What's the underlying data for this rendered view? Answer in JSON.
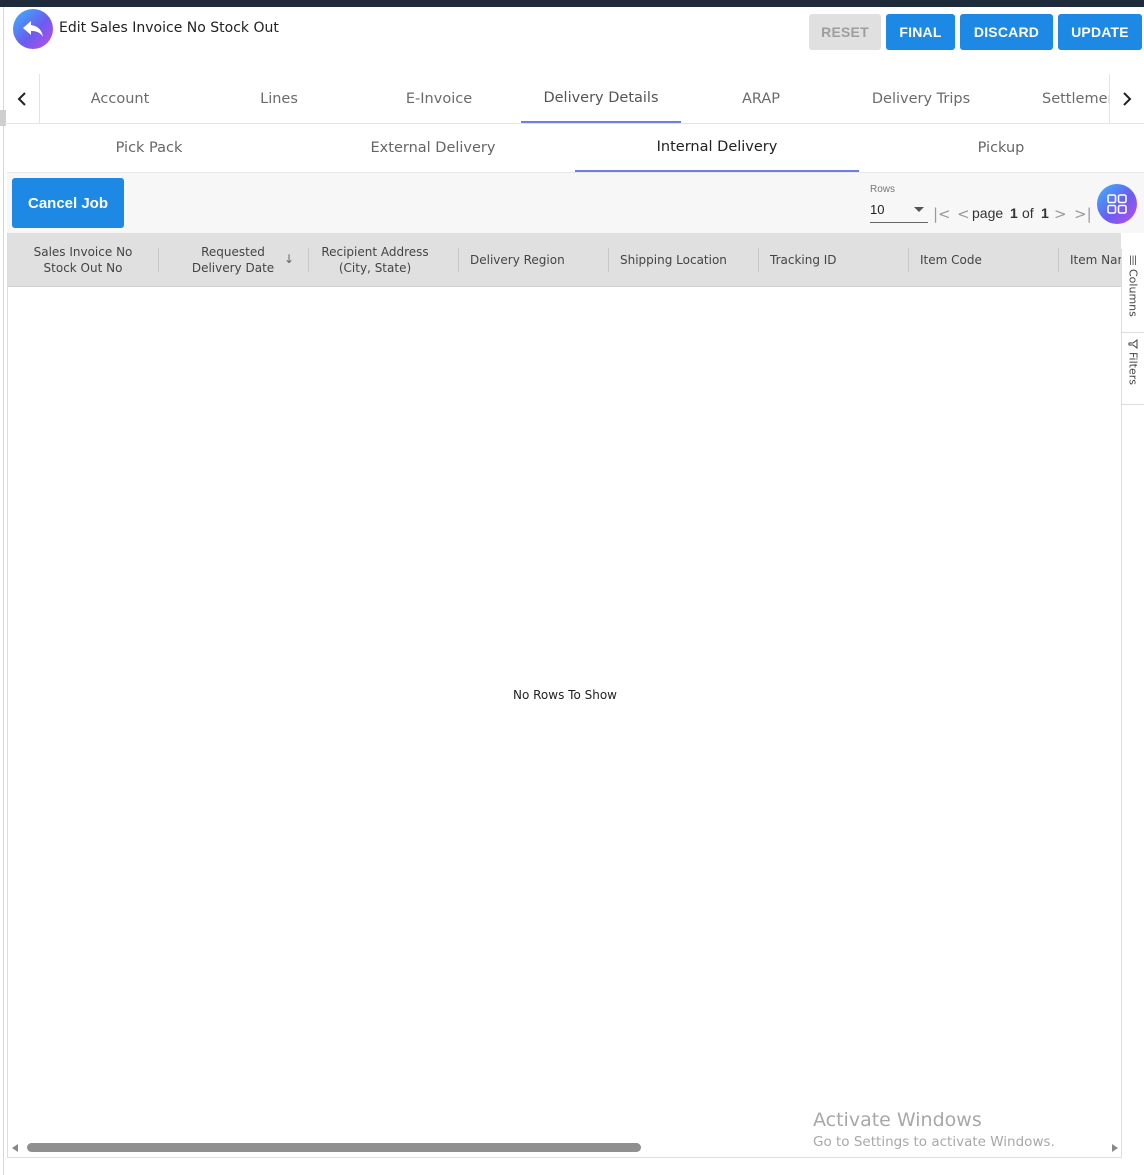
{
  "header": {
    "title": "Edit Sales Invoice No Stock Out",
    "buttons": {
      "reset": "RESET",
      "final": "FINAL",
      "discard": "DISCARD",
      "update": "UPDATE"
    }
  },
  "main_tabs": [
    "Account",
    "Lines",
    "E-Invoice",
    "Delivery Details",
    "ARAP",
    "Delivery Trips",
    "Settlement"
  ],
  "active_main_tab": "Delivery Details",
  "sub_tabs": [
    "Pick Pack",
    "External Delivery",
    "Internal Delivery",
    "Pickup"
  ],
  "active_sub_tab": "Internal Delivery",
  "toolbar": {
    "cancel_job": "Cancel Job",
    "rows_label": "Rows",
    "rows_value": "10",
    "page_word": "page",
    "page_current": "1",
    "of_word": "of",
    "page_total": "1"
  },
  "grid": {
    "columns": [
      {
        "line1": "Sales Invoice No",
        "line2": "Stock Out No"
      },
      {
        "line1": "Requested",
        "line2": "Delivery Date"
      },
      {
        "line1": "Recipient Address",
        "line2": "(City, State)"
      },
      {
        "line1": "Delivery Region",
        "line2": ""
      },
      {
        "line1": "Shipping Location",
        "line2": ""
      },
      {
        "line1": "Tracking ID",
        "line2": ""
      },
      {
        "line1": "Item Code",
        "line2": ""
      },
      {
        "line1": "Item Name",
        "line2": ""
      }
    ],
    "sort_icon": "arrow-down",
    "empty_message": "No Rows To Show"
  },
  "side_panel": {
    "columns": "Columns",
    "filters": "Filters"
  },
  "watermark": {
    "title": "Activate Windows",
    "subtitle": "Go to Settings to activate Windows."
  },
  "colors": {
    "primary": "#1e88e5",
    "tab_underline": "#6f7fe0",
    "header_bg": "#e0e0e0"
  }
}
